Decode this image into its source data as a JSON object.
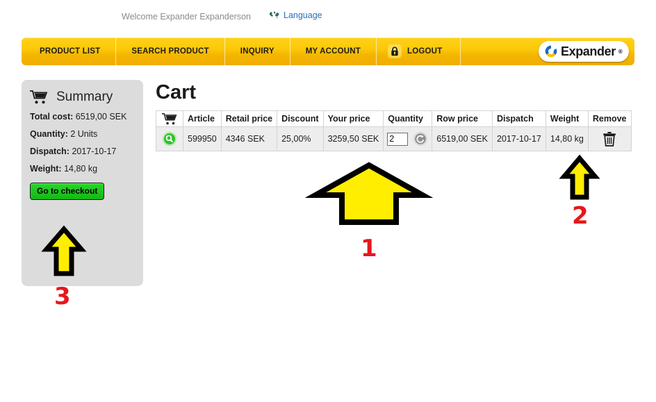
{
  "topbar": {
    "welcome": "Welcome Expander Expanderson",
    "language_label": "Language",
    "globe_icon": "globe-icon"
  },
  "nav": {
    "items": [
      {
        "label": "PRODUCT LIST",
        "icon": null
      },
      {
        "label": "SEARCH PRODUCT",
        "icon": null
      },
      {
        "label": "INQUIRY",
        "icon": null
      },
      {
        "label": "MY ACCOUNT",
        "icon": null
      },
      {
        "label": "LOGOUT",
        "icon": "lock-icon"
      }
    ],
    "logo_text": "Expander",
    "logo_reg": "®",
    "logo_icon": "expander-ring-logo"
  },
  "summary": {
    "title": "Summary",
    "cart_icon": "shopping-cart-icon",
    "rows": [
      {
        "label": "Total cost:",
        "value": "6519,00 SEK"
      },
      {
        "label": "Quantity:",
        "value": "2  Units"
      },
      {
        "label": "Dispatch:",
        "value": "2017-10-17"
      },
      {
        "label": "Weight:",
        "value": "14,80 kg"
      }
    ],
    "checkout_label": "Go to checkout"
  },
  "cart": {
    "heading": "Cart",
    "header_cart_icon": "shopping-cart-icon",
    "columns": [
      "Article",
      "Retail price",
      "Discount",
      "Your price",
      "Quantity",
      "Row price",
      "Dispatch",
      "Weight",
      "Remove"
    ],
    "rows": [
      {
        "view_icon": "magnifier-icon",
        "article": "599950",
        "retail_price": "4346 SEK",
        "discount": "25,00%",
        "your_price": "3259,50 SEK",
        "quantity": "2",
        "update_icon": "refresh-icon",
        "row_price": "6519,00 SEK",
        "dispatch": "2017-10-17",
        "weight": "14,80 kg",
        "remove_icon": "trash-icon"
      }
    ]
  },
  "annotations": [
    {
      "id": "1",
      "number": "1",
      "points_to": "quantity-field",
      "arrow_icon": "up-arrow-icon"
    },
    {
      "id": "2",
      "number": "2",
      "points_to": "remove-button",
      "arrow_icon": "up-arrow-icon"
    },
    {
      "id": "3",
      "number": "3",
      "points_to": "checkout-button",
      "arrow_icon": "up-arrow-icon"
    }
  ],
  "colors": {
    "nav_yellow": "#fdc80a",
    "link_blue": "#2a6ebb",
    "checkout_green": "#1fc41f",
    "annotation_yellow": "#ffee00",
    "annotation_red": "#e8161d",
    "panel_gray": "#dcdcdc",
    "row_gray": "#ededed"
  }
}
